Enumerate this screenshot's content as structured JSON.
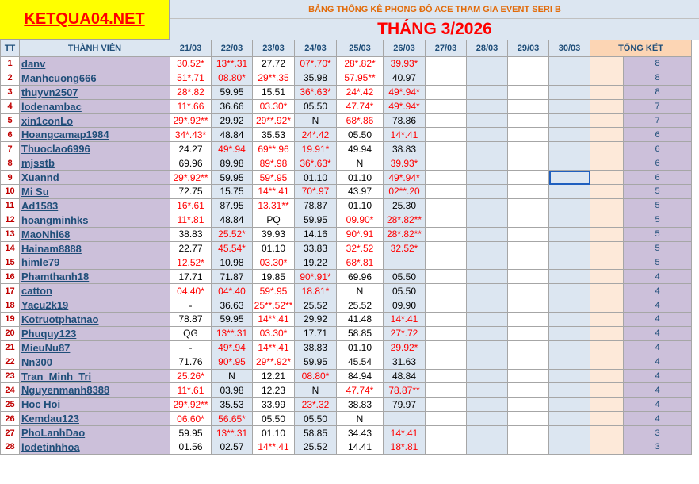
{
  "logo": {
    "text": "KETQUA04.NET"
  },
  "banner": {
    "title": "BẢNG THỐNG KÊ PHONG ĐỘ ACE THAM GIA EVENT SERI B",
    "month": "THÁNG 3/2026"
  },
  "headers": {
    "tt": "TT",
    "member": "THÀNH VIÊN",
    "dates": [
      "21/03",
      "22/03",
      "23/03",
      "24/03",
      "25/03",
      "26/03",
      "27/03",
      "28/03",
      "29/03",
      "30/03"
    ],
    "total": "TỔNG KẾT"
  },
  "colors": {
    "red_text": "#ff0000",
    "name_bg": "#ccc0da",
    "header_bg": "#dce6f1",
    "logo_bg": "#ffff00"
  },
  "rows": [
    {
      "tt": "1",
      "name": "danv",
      "vals": [
        "30.52*",
        "13**.31",
        "27.72",
        "07*.70*",
        "28*.82*",
        "39.93*"
      ],
      "red": [
        1,
        1,
        0,
        1,
        1,
        1
      ],
      "total": "8"
    },
    {
      "tt": "2",
      "name": "Manhcuong666",
      "vals": [
        "51*.71",
        "08.80*",
        "29**.35",
        "35.98",
        "57.95**",
        "40.97"
      ],
      "red": [
        1,
        1,
        1,
        0,
        1,
        0
      ],
      "total": "8"
    },
    {
      "tt": "3",
      "name": "thuyvn2507",
      "vals": [
        "28*.82",
        "59.95",
        "15.51",
        "36*.63*",
        "24*.42",
        "49*.94*"
      ],
      "red": [
        1,
        0,
        0,
        1,
        1,
        1
      ],
      "total": "8"
    },
    {
      "tt": "4",
      "name": "lodenambac",
      "vals": [
        "11*.66",
        "36.66",
        "03.30*",
        "05.50",
        "47.74*",
        "49*.94*"
      ],
      "red": [
        1,
        0,
        1,
        0,
        1,
        1
      ],
      "total": "7"
    },
    {
      "tt": "5",
      "name": "xin1conLo",
      "vals": [
        "29*.92**",
        "29.92",
        "29**.92*",
        "N",
        "68*.86",
        "78.86"
      ],
      "red": [
        1,
        0,
        1,
        0,
        1,
        0
      ],
      "total": "7"
    },
    {
      "tt": "6",
      "name": "Hoangcamap1984",
      "vals": [
        "34*.43*",
        "48.84",
        "35.53",
        "24*.42",
        "05.50",
        "14*.41"
      ],
      "red": [
        1,
        0,
        0,
        1,
        0,
        1
      ],
      "total": "6"
    },
    {
      "tt": "7",
      "name": "Thuoclao6996",
      "vals": [
        "24.27",
        "49*.94",
        "69**.96",
        "19.91*",
        "49.94",
        "38.83"
      ],
      "red": [
        0,
        1,
        1,
        1,
        0,
        0
      ],
      "total": "6"
    },
    {
      "tt": "8",
      "name": "mjsstb",
      "vals": [
        "69.96",
        "89.98",
        "89*.98",
        "36*.63*",
        "N",
        "39.93*"
      ],
      "red": [
        0,
        0,
        1,
        1,
        0,
        1
      ],
      "total": "6"
    },
    {
      "tt": "9",
      "name": "Xuannd",
      "vals": [
        "29*.92**",
        "59.95",
        "59*.95",
        "01.10",
        "01.10",
        "49*.94*"
      ],
      "red": [
        1,
        0,
        1,
        0,
        0,
        1
      ],
      "total": "6"
    },
    {
      "tt": "10",
      "name": "Mi Su",
      "vals": [
        "72.75",
        "15.75",
        "14**.41",
        "70*.97",
        "43.97",
        "02**.20"
      ],
      "red": [
        0,
        0,
        1,
        1,
        0,
        1
      ],
      "total": "5"
    },
    {
      "tt": "11",
      "name": "Ad1583",
      "vals": [
        "16*.61",
        "87.95",
        "13.31**",
        "78.87",
        "01.10",
        "25.30"
      ],
      "red": [
        1,
        0,
        1,
        0,
        0,
        0
      ],
      "total": "5"
    },
    {
      "tt": "12",
      "name": "hoangminhks",
      "vals": [
        "11*.81",
        "48.84",
        "PQ",
        "59.95",
        "09.90*",
        "28*.82**"
      ],
      "red": [
        1,
        0,
        0,
        0,
        1,
        1
      ],
      "total": "5"
    },
    {
      "tt": "13",
      "name": "MaoNhi68",
      "vals": [
        "38.83",
        "25.52*",
        "39.93",
        "14.16",
        "90*.91",
        "28*.82**"
      ],
      "red": [
        0,
        1,
        0,
        0,
        1,
        1
      ],
      "total": "5"
    },
    {
      "tt": "14",
      "name": "Hainam8888",
      "vals": [
        "22.77",
        "45.54*",
        "01.10",
        "33.83",
        "32*.52",
        "32.52*"
      ],
      "red": [
        0,
        1,
        0,
        0,
        1,
        1
      ],
      "total": "5"
    },
    {
      "tt": "15",
      "name": "himle79",
      "vals": [
        "12.52*",
        "10.98",
        "03.30*",
        "19.22",
        "68*.81",
        ""
      ],
      "red": [
        1,
        0,
        1,
        0,
        1,
        0
      ],
      "total": "5"
    },
    {
      "tt": "16",
      "name": "Phamthanh18",
      "vals": [
        "17.71",
        "71.87",
        "19.85",
        "90*.91*",
        "69.96",
        "05.50"
      ],
      "red": [
        0,
        0,
        0,
        1,
        0,
        0
      ],
      "total": "4"
    },
    {
      "tt": "17",
      "name": "catton",
      "vals": [
        "04.40*",
        "04*.40",
        "59*.95",
        "18.81*",
        "N",
        "05.50"
      ],
      "red": [
        1,
        1,
        1,
        1,
        0,
        0
      ],
      "total": "4"
    },
    {
      "tt": "18",
      "name": "Yacu2k19",
      "vals": [
        "-",
        "36.63",
        "25**.52**",
        "25.52",
        "25.52",
        "09.90"
      ],
      "red": [
        0,
        0,
        1,
        0,
        0,
        0
      ],
      "total": "4"
    },
    {
      "tt": "19",
      "name": "Kotruotphatnao",
      "vals": [
        "78.87",
        "59.95",
        "14**.41",
        "29.92",
        "41.48",
        "14*.41"
      ],
      "red": [
        0,
        0,
        1,
        0,
        0,
        1
      ],
      "total": "4"
    },
    {
      "tt": "20",
      "name": "Phuquy123",
      "vals": [
        "QG",
        "13**.31",
        "03.30*",
        "17.71",
        "58.85",
        "27*.72"
      ],
      "red": [
        0,
        1,
        1,
        0,
        0,
        1
      ],
      "total": "4"
    },
    {
      "tt": "21",
      "name": "MieuNu87",
      "vals": [
        "-",
        "49*.94",
        "14**.41",
        "38.83",
        "01.10",
        "29.92*"
      ],
      "red": [
        0,
        1,
        1,
        0,
        0,
        1
      ],
      "total": "4"
    },
    {
      "tt": "22",
      "name": "Nn300",
      "vals": [
        "71.76",
        "90*.95",
        "29**.92*",
        "59.95",
        "45.54",
        "31.63"
      ],
      "red": [
        0,
        1,
        1,
        0,
        0,
        0
      ],
      "total": "4"
    },
    {
      "tt": "23",
      "name": "Tran_Minh_Tri",
      "vals": [
        "25.26*",
        "N",
        "12.21",
        "08.80*",
        "84.94",
        "48.84"
      ],
      "red": [
        1,
        0,
        0,
        1,
        0,
        0
      ],
      "total": "4"
    },
    {
      "tt": "24",
      "name": "Nguyenmanh8388",
      "vals": [
        "11*.61",
        "03.98",
        "12.23",
        "N",
        "47.74*",
        "78.87**"
      ],
      "red": [
        1,
        0,
        0,
        0,
        1,
        1
      ],
      "total": "4"
    },
    {
      "tt": "25",
      "name": "Hoc Hoi",
      "vals": [
        "29*.92**",
        "35.53",
        "33.99",
        "23*.32",
        "38.83",
        "79.97"
      ],
      "red": [
        1,
        0,
        0,
        1,
        0,
        0
      ],
      "total": "4"
    },
    {
      "tt": "26",
      "name": "Kemdau123",
      "vals": [
        "06.60*",
        "56.65*",
        "05.50",
        "05.50",
        "N",
        ""
      ],
      "red": [
        1,
        1,
        0,
        0,
        0,
        0
      ],
      "total": "4"
    },
    {
      "tt": "27",
      "name": "PhoLanhDao",
      "vals": [
        "59.95",
        "13**.31",
        "01.10",
        "58.85",
        "34.43",
        "14*.41"
      ],
      "red": [
        0,
        1,
        0,
        0,
        0,
        1
      ],
      "total": "3"
    },
    {
      "tt": "28",
      "name": "lodetinhhoa",
      "vals": [
        "01.56",
        "02.57",
        "14**.41",
        "25.52",
        "14.41",
        "18*.81"
      ],
      "red": [
        0,
        0,
        1,
        0,
        0,
        1
      ],
      "total": "3"
    }
  ]
}
